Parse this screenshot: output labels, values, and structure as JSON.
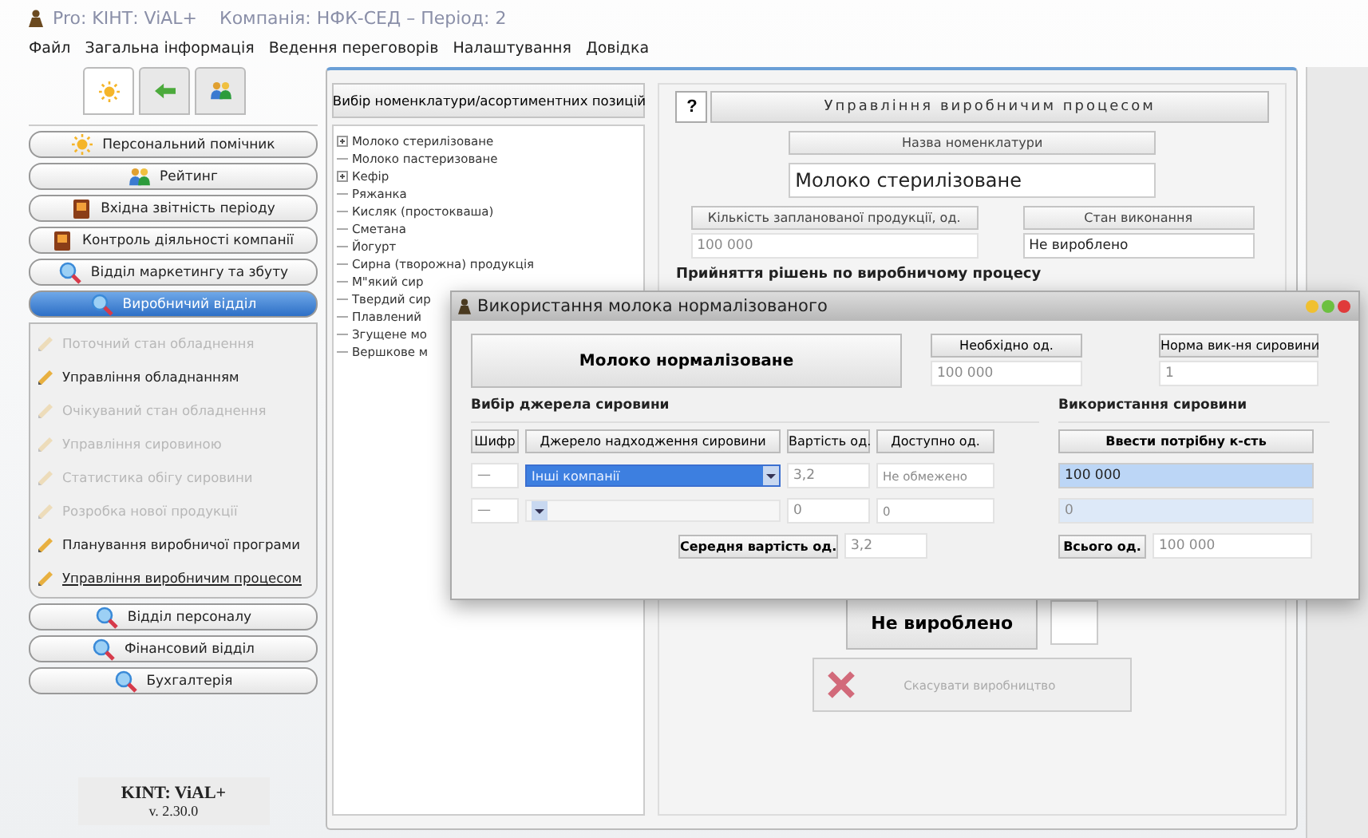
{
  "window": {
    "title": "Pro: KIНТ: ViAL+",
    "company": "Компанія: НФК-СЕД – Період: 2"
  },
  "menu": [
    "Файл",
    "Загальна інформація",
    "Ведення переговорів",
    "Налаштування",
    "Довідка"
  ],
  "sidebar": {
    "tabs": [
      {
        "kind": "sun",
        "selected": true
      },
      {
        "kind": "arrow",
        "selected": false
      },
      {
        "kind": "people",
        "selected": false
      }
    ],
    "sections": [
      {
        "label": "Персональний помічник",
        "kind": "sun",
        "selected": false
      },
      {
        "label": "Рейтинг",
        "kind": "people",
        "selected": false
      },
      {
        "label": "Вхідна звітність періоду",
        "kind": "book",
        "selected": false
      },
      {
        "label": "Контроль діяльності компанії",
        "kind": "book",
        "selected": false
      },
      {
        "label": "Відділ маркетингу та збуту",
        "kind": "search",
        "selected": false
      },
      {
        "label": "Виробничий відділ",
        "kind": "search",
        "selected": true,
        "children": [
          {
            "label": "Поточний стан обладнення",
            "disabled": true,
            "selected": false
          },
          {
            "label": "Управління обладнанням",
            "disabled": false,
            "selected": false
          },
          {
            "label": "Очікуваний стан обладнення",
            "disabled": true,
            "selected": false
          },
          {
            "label": "Управління сировиною",
            "disabled": true,
            "selected": false
          },
          {
            "label": "Статистика обігу сировини",
            "disabled": true,
            "selected": false
          },
          {
            "label": "Розробка нової продукції",
            "disabled": true,
            "selected": false
          },
          {
            "label": "Планування виробничої програми",
            "disabled": false,
            "selected": false
          },
          {
            "label": "Управління виробничим процесом",
            "disabled": false,
            "selected": true
          }
        ]
      },
      {
        "label": "Відділ персоналу",
        "kind": "search",
        "selected": false
      },
      {
        "label": "Фінансовий відділ",
        "kind": "search",
        "selected": false
      },
      {
        "label": "Бухгалтерія",
        "kind": "search",
        "selected": false
      }
    ],
    "brand": "KINT: ViAL+",
    "version": "v. 2.30.0"
  },
  "nomenclature": {
    "header": "Вибір номенклатури/асортиментних позицій",
    "items": [
      {
        "label": "Молоко стерилізоване",
        "expandable": true
      },
      {
        "label": "Молоко пастеризоване",
        "expandable": false
      },
      {
        "label": "Кефір",
        "expandable": true
      },
      {
        "label": "Ряжанка",
        "expandable": false
      },
      {
        "label": "Кисляк (простокваша)",
        "expandable": false
      },
      {
        "label": "Сметана",
        "expandable": false
      },
      {
        "label": "Йогурт",
        "expandable": false
      },
      {
        "label": "Сирна (творожна) продукція",
        "expandable": false
      },
      {
        "label": "М\"який сир",
        "expandable": false
      },
      {
        "label": "Твердий сир",
        "expandable": false
      },
      {
        "label": "Плавлений",
        "expandable": false
      },
      {
        "label": "Згущене мо",
        "expandable": false
      },
      {
        "label": "Вершкове м",
        "expandable": false
      }
    ]
  },
  "process": {
    "help": "?",
    "title": "Управління виробничим процесом",
    "name_label": "Назва номенклатури",
    "name_value": "Молоко стерилізоване",
    "quantity_label": "Кількість запланованої продукції, од.",
    "quantity_value": "100 000",
    "status_label": "Стан виконання",
    "status_value": "Не вироблено",
    "decision_title": "Прийняття рішень по виробничому процесу",
    "status_button": "Не вироблено",
    "cancel_button": "Скасувати виробництво"
  },
  "dialog": {
    "title": "Використання молока нормалізованого",
    "product": "Молоко нормалізоване",
    "needed_label": "Необхідно од.",
    "needed_value": "100 000",
    "norm_label": "Норма вик-ня сировини",
    "norm_value": "1",
    "source_title": "Вибір джерела сировини",
    "columns": [
      "Шифр",
      "Джерело надходження сировини",
      "Вартість од.",
      "Доступно од."
    ],
    "rows": [
      {
        "code": "—",
        "source": "Інші компанії",
        "cost": "3,2",
        "available": "Не обмежено",
        "usage": "100 000",
        "selected": true
      },
      {
        "code": "—",
        "source": "",
        "cost": "0",
        "available": "0",
        "usage": "0",
        "selected": false
      }
    ],
    "avg_label": "Середня вартість од.",
    "avg_value": "3,2",
    "usage_title": "Використання сировини",
    "enter_button": "Ввести потрібну к-сть",
    "total_label": "Всього од.",
    "total_value": "100 000"
  }
}
